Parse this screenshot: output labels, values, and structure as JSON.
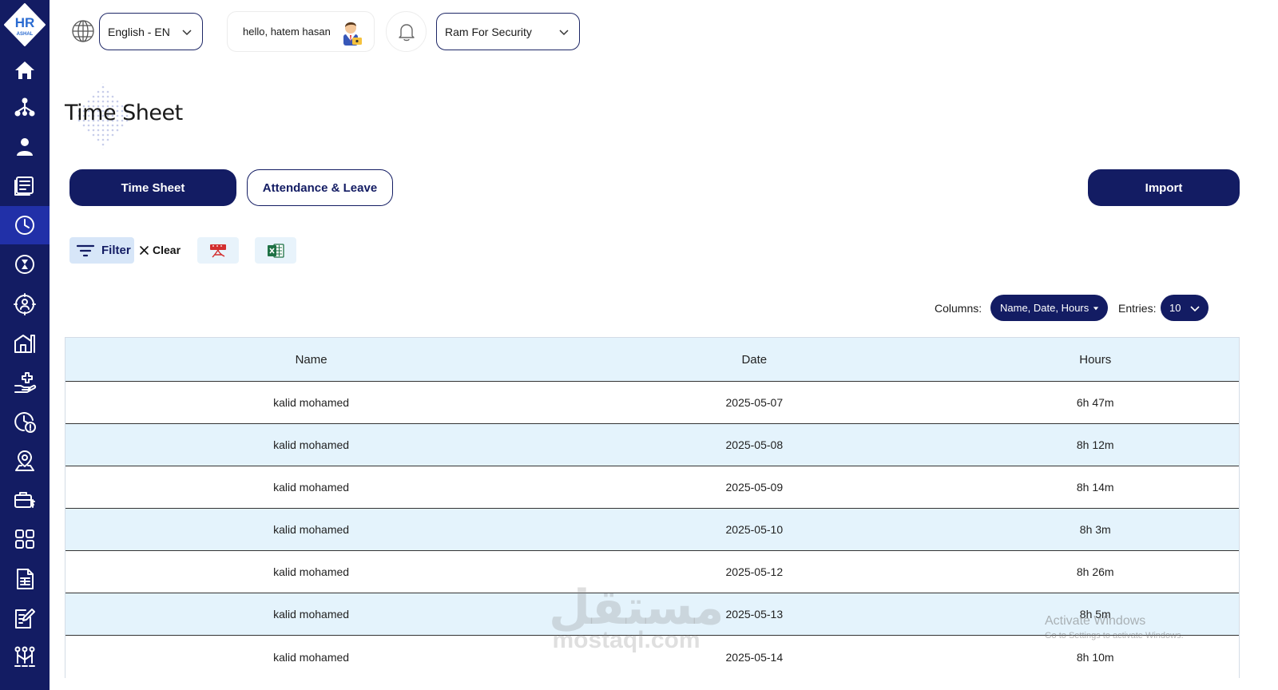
{
  "brand": {
    "logo_text": "HR",
    "logo_sub": "ASHAL"
  },
  "sidebar": {
    "items": [
      {
        "name": "home",
        "icon": "home-icon"
      },
      {
        "name": "organization",
        "icon": "org-chart-icon"
      },
      {
        "name": "employees",
        "icon": "user-icon"
      },
      {
        "name": "reports",
        "icon": "document-list-icon"
      },
      {
        "name": "timesheet",
        "icon": "clock-icon",
        "active": true
      },
      {
        "name": "shifts",
        "icon": "hourglass-icon"
      },
      {
        "name": "roles",
        "icon": "user-settings-icon"
      },
      {
        "name": "branches",
        "icon": "building-icon"
      },
      {
        "name": "medical",
        "icon": "hand-plus-icon"
      },
      {
        "name": "overtime",
        "icon": "clock-alert-icon"
      },
      {
        "name": "locations",
        "icon": "user-pin-icon"
      },
      {
        "name": "payroll",
        "icon": "briefcase-dollar-icon"
      },
      {
        "name": "modules",
        "icon": "grid-icon"
      },
      {
        "name": "forms",
        "icon": "spreadsheet-icon"
      },
      {
        "name": "requests",
        "icon": "edit-document-icon"
      },
      {
        "name": "workflow",
        "icon": "workflow-icon"
      }
    ]
  },
  "topbar": {
    "language": "English - EN",
    "greeting": "hello, hatem hasan",
    "company": "Ram For Security"
  },
  "page": {
    "title": "Time Sheet"
  },
  "tabs": {
    "timesheet": "Time Sheet",
    "attendance": "Attendance & Leave"
  },
  "actions": {
    "import": "Import",
    "filter": "Filter",
    "clear": "Clear"
  },
  "table_controls": {
    "columns_label": "Columns:",
    "columns_value": "Name, Date, Hours",
    "entries_label": "Entries:",
    "entries_value": "10"
  },
  "table": {
    "headers": [
      "Name",
      "Date",
      "Hours"
    ],
    "rows": [
      [
        "kalid mohamed",
        "2025-05-07",
        "6h 47m"
      ],
      [
        "kalid mohamed",
        "2025-05-08",
        "8h 12m"
      ],
      [
        "kalid mohamed",
        "2025-05-09",
        "8h 14m"
      ],
      [
        "kalid mohamed",
        "2025-05-10",
        "8h 3m"
      ],
      [
        "kalid mohamed",
        "2025-05-12",
        "8h 26m"
      ],
      [
        "kalid mohamed",
        "2025-05-13",
        "8h 5m"
      ],
      [
        "kalid mohamed",
        "2025-05-14",
        "8h 10m"
      ]
    ]
  },
  "overlay": {
    "watermark_ar": "مستقل",
    "watermark_en": "mostaql.com",
    "activate_title": "Activate Windows",
    "activate_sub": "Go to Settings to activate Windows."
  },
  "colors": {
    "primary": "#131c63",
    "active_nav": "#2130a8",
    "row_alt": "#e4f3fc",
    "filter_bg": "#d7e6f8"
  }
}
